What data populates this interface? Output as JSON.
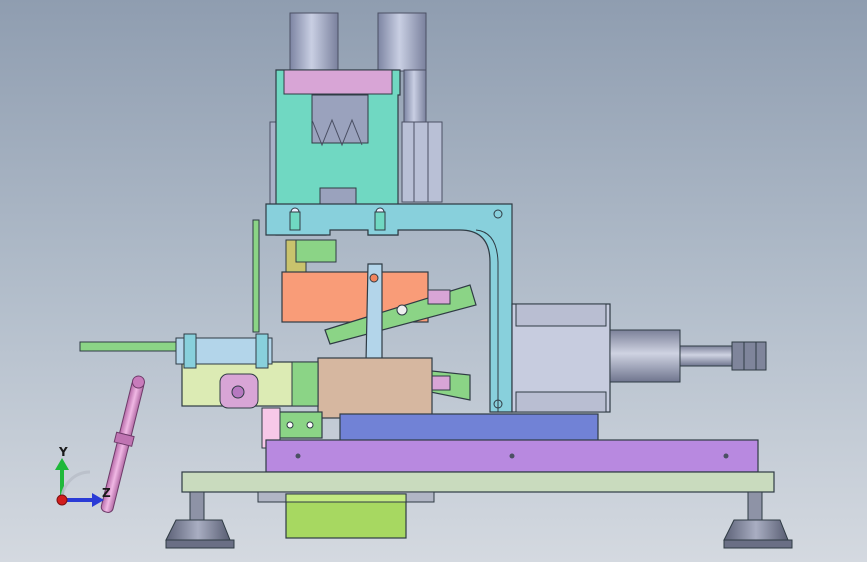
{
  "viewport": {
    "background_top": "#8f9db0",
    "background_bottom": "#d4d9e0"
  },
  "triad": {
    "y_label": "Y",
    "z_label": "Z",
    "y_color": "#1fb83a",
    "z_color": "#2a3bd6",
    "x_color": "#d21d1d"
  },
  "part_colors": {
    "cylinder_steel": "#9aa2bd",
    "upper_frame": "#70d8c2",
    "head_plate": "#d8a5d6",
    "bracket": "#88d0dc",
    "salmon_block": "#f99c78",
    "green_link": "#8bd486",
    "cream_block": "#dcebb4",
    "tan_block": "#d6b7a0",
    "blue_plate": "#7182d6",
    "violet_plate": "#b889e0",
    "base_plate": "#c9dbbe",
    "yellow_green_box": "#a7d861",
    "pink_tool": "#d688c9",
    "actuator_body": "#c7ccdf",
    "actuator_rod": "#9ca1b2",
    "foot": "#868ba0"
  }
}
